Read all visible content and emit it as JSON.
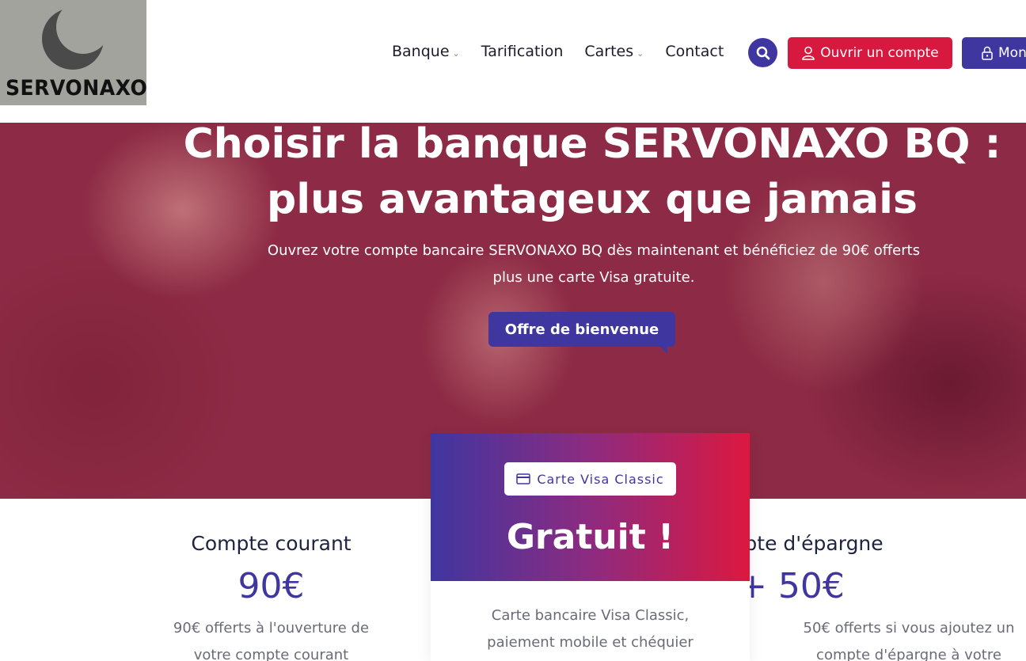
{
  "logo": {
    "text": "SERVONAXO"
  },
  "nav": {
    "items": [
      {
        "label": "Banque",
        "has_dropdown": true
      },
      {
        "label": "Tarification",
        "has_dropdown": false
      },
      {
        "label": "Cartes",
        "has_dropdown": true
      },
      {
        "label": "Contact",
        "has_dropdown": false
      }
    ],
    "search_icon": "search-icon",
    "open_account_label": "Ouvrir un compte",
    "my_account_label": "Mon"
  },
  "hero": {
    "title": "Choisir la banque SERVONAXO BQ : plus avantageux que jamais",
    "subtitle": "Ouvrez votre compte bancaire SERVONAXO BQ dès maintenant et bénéficiez de 90€ offerts plus une carte Visa gratuite.",
    "cta_label": "Offre de bienvenue"
  },
  "cards": {
    "left": {
      "title": "Compte courant",
      "price": "90€",
      "description": "90€ offerts à l'ouverture de votre compte courant"
    },
    "middle": {
      "badge": "Carte Visa Classic",
      "price": "Gratuit !",
      "description": "Carte bancaire Visa Classic, paiement mobile et chéquier"
    },
    "right": {
      "title": "Compte d'épargne",
      "price": "+ 50€",
      "description": "50€ offerts si vous ajoutez un compte d'épargne à votre"
    }
  },
  "colors": {
    "primary": "#3f36a0",
    "accent": "#d7193f",
    "hero_overlay": "#8d2a45"
  }
}
